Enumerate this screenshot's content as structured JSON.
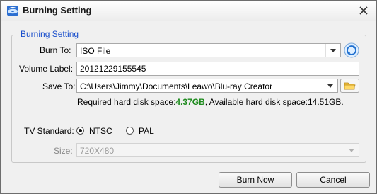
{
  "window": {
    "title": "Burning Setting"
  },
  "group": {
    "legend": "Burning Setting"
  },
  "burn_to": {
    "label": "Burn To:",
    "value": "ISO File"
  },
  "volume_label": {
    "label": "Volume Label:",
    "value": "20121229155545"
  },
  "save_to": {
    "label": "Save To:",
    "value": "C:\\Users\\Jimmy\\Documents\\Leawo\\Blu-ray Creator"
  },
  "disk_space": {
    "required_prefix": "Required hard disk space:",
    "required_value": "4.37GB",
    "available_text": ", Available hard disk space:14.51GB."
  },
  "tv_standard": {
    "label": "TV Standard:",
    "options": [
      "NTSC",
      "PAL"
    ],
    "selected": "NTSC"
  },
  "size": {
    "label": "Size:",
    "value": "720X480"
  },
  "buttons": {
    "burn_now": "Burn Now",
    "cancel": "Cancel"
  },
  "colors": {
    "legend": "#1a4fcc",
    "required_space": "#1e8b1e"
  }
}
